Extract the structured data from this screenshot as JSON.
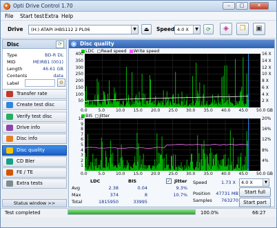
{
  "window": {
    "title": "Opti Drive Control 1.70",
    "min": "–",
    "max": "□",
    "close": "✕"
  },
  "menu": [
    "File",
    "Start test",
    "Extra",
    "Help"
  ],
  "toolbar": {
    "drive_label": "Drive",
    "drive_value": "(H:)  ATAPI iHBS112   2 PL06",
    "speed_label": "Speed",
    "speed_value": "4.0 X"
  },
  "disc": {
    "header": "Disc",
    "fields": [
      {
        "key": "Type",
        "value": "BD-R DL"
      },
      {
        "key": "MID",
        "value": "MEIRB1 (001)"
      },
      {
        "key": "Length",
        "value": "46.61 GB"
      },
      {
        "key": "Contents",
        "value": "data"
      },
      {
        "key": "Label",
        "value": ""
      }
    ]
  },
  "nav": [
    {
      "label": "Transfer rate",
      "active": false,
      "color": "#c0392b"
    },
    {
      "label": "Create test disc",
      "active": false,
      "color": "#2e86de"
    },
    {
      "label": "Verify test disc",
      "active": false,
      "color": "#27ae60"
    },
    {
      "label": "Drive info",
      "active": false,
      "color": "#8e44ad"
    },
    {
      "label": "Disc info",
      "active": false,
      "color": "#e67e22"
    },
    {
      "label": "Disc quality",
      "active": true,
      "color": "#f1c40f"
    },
    {
      "label": "CD Bler",
      "active": false,
      "color": "#16a085"
    },
    {
      "label": "FE / TE",
      "active": false,
      "color": "#d35400"
    },
    {
      "label": "Extra tests",
      "active": false,
      "color": "#7f8c8d"
    }
  ],
  "status_window_btn": "Status window >>",
  "panel_title": "Disc quality",
  "chart_data": [
    {
      "type": "bar",
      "legend": [
        {
          "name": "LDC",
          "color": "#00cc00"
        },
        {
          "name": "Read speed",
          "color": "#ffffff"
        },
        {
          "name": "Write speed",
          "color": "#ff55ff"
        }
      ],
      "x_ticks": [
        "0.0",
        "5.0",
        "10.0",
        "15.0",
        "20.0",
        "25.0",
        "30.0",
        "35.0",
        "40.0",
        "45.0",
        "50.0 GB"
      ],
      "y_left_ticks": [
        "400",
        "350",
        "300",
        "250",
        "200",
        "150",
        "100",
        "50"
      ],
      "y_right_ticks": [
        "16 X",
        "14 X",
        "12 X",
        "10 X",
        "8 X",
        "6 X",
        "4 X",
        "2 X"
      ],
      "xlim": [
        0,
        50
      ],
      "ylim": [
        0,
        400
      ],
      "speed_curve": {
        "start": 1.73,
        "end": 4.0
      },
      "disc_end_gb": 46.61
    },
    {
      "type": "bar",
      "legend": [
        {
          "name": "BIS",
          "color": "#00cc00"
        },
        {
          "name": "Jitter",
          "color": "#ffffff"
        }
      ],
      "x_ticks": [
        "0.0",
        "5.0",
        "10.0",
        "15.0",
        "20.0",
        "25.0",
        "30.0",
        "35.0",
        "40.0",
        "45.0",
        "50.0 GB"
      ],
      "y_left_ticks": [
        "10",
        "9",
        "8",
        "7",
        "6",
        "5",
        "4",
        "3",
        "2",
        "1"
      ],
      "y_right_ticks": [
        "20%",
        "16%",
        "12%",
        "8%",
        "4%"
      ],
      "xlim": [
        0,
        50
      ],
      "ylim": [
        0,
        10
      ],
      "jitter_left": 8.8,
      "jitter_right": 10.0,
      "disc_end_gb": 46.61
    }
  ],
  "stats": {
    "headers": {
      "ldc": "LDC",
      "bis": "BIS",
      "jitter": "Jitter"
    },
    "rows": [
      {
        "label": "Avg",
        "ldc": "2.38",
        "bis": "0.04",
        "jitter": "9.3%"
      },
      {
        "label": "Max",
        "ldc": "374",
        "bis": "8",
        "jitter": "10.7%"
      },
      {
        "label": "Total",
        "ldc": "1815950",
        "bis": "33995",
        "jitter": ""
      }
    ],
    "jitter_checked": true
  },
  "right": {
    "speed_label": "Speed",
    "speed_value": "1.73 X",
    "speed_select": "4.0 X",
    "position_label": "Position",
    "position_value": "47731 MB",
    "samples_label": "Samples",
    "samples_value": "763270",
    "start_full": "Start full",
    "start_part": "Start part"
  },
  "statusbar": {
    "text": "Test completed",
    "progress": 1.0,
    "percent": "100.0%",
    "time": "66:27"
  }
}
